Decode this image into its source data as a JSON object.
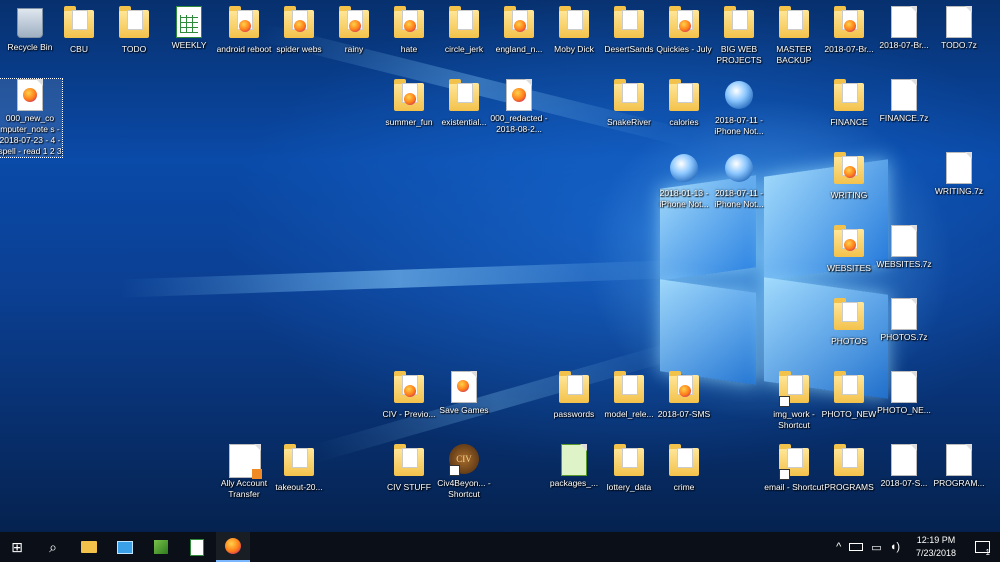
{
  "desktop": {
    "icons": [
      {
        "name": "recycle-bin-icon",
        "type": "bin",
        "label": "Recycle Bin",
        "col": 0,
        "row": 0
      },
      {
        "name": "cbu-folder-icon",
        "type": "folder",
        "label": "CBU",
        "col": 1,
        "row": 0
      },
      {
        "name": "todo-folder-icon",
        "type": "folder",
        "label": "TODO",
        "col": 2,
        "row": 0
      },
      {
        "name": "weekly-spreadsheet-icon",
        "type": "sheet",
        "label": "WEEKLY",
        "col": 3,
        "row": 0
      },
      {
        "name": "android-reboot-folder-icon",
        "type": "folder-ff",
        "label": "android reboot",
        "col": 4,
        "row": 0
      },
      {
        "name": "spider-webs-folder-icon",
        "type": "folder-ff",
        "label": "spider webs",
        "col": 5,
        "row": 0
      },
      {
        "name": "rainy-folder-icon",
        "type": "folder-ff",
        "label": "rainy",
        "col": 6,
        "row": 0
      },
      {
        "name": "hate-folder-icon",
        "type": "folder-ff",
        "label": "hate",
        "col": 7,
        "row": 0
      },
      {
        "name": "circle-jerk-folder-icon",
        "type": "folder",
        "label": "circle_jerk",
        "col": 8,
        "row": 0
      },
      {
        "name": "england-folder-icon",
        "type": "folder-ff",
        "label": "england_n...",
        "col": 9,
        "row": 0
      },
      {
        "name": "moby-dick-folder-icon",
        "type": "folder",
        "label": "Moby Dick",
        "col": 10,
        "row": 0
      },
      {
        "name": "desertsands-folder-icon",
        "type": "folder",
        "label": "DesertSands",
        "col": 11,
        "row": 0
      },
      {
        "name": "quickies-july-folder-icon",
        "type": "folder-ff",
        "label": "Quickies - July",
        "col": 12,
        "row": 0
      },
      {
        "name": "big-web-projects-folder-icon",
        "type": "folder",
        "label": "BIG WEB PROJECTS",
        "col": 13,
        "row": 0
      },
      {
        "name": "master-backup-folder-icon",
        "type": "folder",
        "label": "MASTER BACKUP",
        "col": 14,
        "row": 0
      },
      {
        "name": "br-folder-icon",
        "type": "folder-ff",
        "label": "2018-07-Br...",
        "col": 15,
        "row": 0
      },
      {
        "name": "br-file-icon",
        "type": "file",
        "label": "2018-07-Br...",
        "col": 16,
        "row": 0
      },
      {
        "name": "todo-7z-file-icon",
        "type": "file",
        "label": "TODO.7z",
        "col": 17,
        "row": 0
      },
      {
        "name": "new-computer-notes-firefox-icon",
        "type": "firefox",
        "label": "000_new_co mputer_note s - 2018-07-23 - 4 - spell - read 1 2 3",
        "col": 0,
        "row": 1,
        "selected": true
      },
      {
        "name": "summer-fun-folder-icon",
        "type": "folder-ff",
        "label": "summer_fun",
        "col": 7,
        "row": 1
      },
      {
        "name": "existential-folder-icon",
        "type": "folder",
        "label": "existential...",
        "col": 8,
        "row": 1
      },
      {
        "name": "redacted-firefox-icon",
        "type": "firefox-file",
        "label": "000_redacted - 2018-08-2...",
        "col": 9,
        "row": 1
      },
      {
        "name": "snakeriver-folder-icon",
        "type": "folder",
        "label": "SnakeRiver",
        "col": 11,
        "row": 1
      },
      {
        "name": "calories-folder-icon",
        "type": "folder",
        "label": "calories",
        "col": 12,
        "row": 1
      },
      {
        "name": "iphone-notes-0711-icon",
        "type": "tbird",
        "label": "2018-07-11 - iPhone Not...",
        "col": 13,
        "row": 1
      },
      {
        "name": "finance-folder-icon",
        "type": "folder",
        "label": "FINANCE",
        "col": 15,
        "row": 1
      },
      {
        "name": "finance-7z-file-icon",
        "type": "file",
        "label": "FINANCE.7z",
        "col": 16,
        "row": 1
      },
      {
        "name": "iphone-notes-0113-icon",
        "type": "tbird",
        "label": "2018-01-13 - iPhone Not...",
        "col": 12,
        "row": 2
      },
      {
        "name": "iphone-notes-0711b-icon",
        "type": "tbird",
        "label": "2018-07-11 - iPhone Not...",
        "col": 13,
        "row": 2
      },
      {
        "name": "writing-folder-icon",
        "type": "folder-ff",
        "label": "WRITING",
        "col": 15,
        "row": 2
      },
      {
        "name": "writing-7z-file-icon",
        "type": "file",
        "label": "WRITING.7z",
        "col": 17,
        "row": 2
      },
      {
        "name": "websites-folder-icon",
        "type": "folder-ff",
        "label": "WEBSITES",
        "col": 15,
        "row": 3
      },
      {
        "name": "websites-7z-file-icon",
        "type": "file",
        "label": "WEBSITES.7z",
        "col": 16,
        "row": 3
      },
      {
        "name": "photos-folder-icon",
        "type": "folder",
        "label": "PHOTOS",
        "col": 15,
        "row": 4
      },
      {
        "name": "photos-7z-file-icon",
        "type": "file",
        "label": "PHOTOS.7z",
        "col": 16,
        "row": 4
      },
      {
        "name": "civ-previous-folder-icon",
        "type": "folder-ff",
        "label": "CIV - Previo...",
        "col": 7,
        "row": 5
      },
      {
        "name": "save-games-shortcut-icon",
        "type": "file-ff",
        "label": "Save Games",
        "col": 8,
        "row": 5
      },
      {
        "name": "passwords-folder-icon",
        "type": "folder",
        "label": "passwords",
        "col": 10,
        "row": 5
      },
      {
        "name": "model-release-folder-icon",
        "type": "folder",
        "label": "model_rele...",
        "col": 11,
        "row": 5
      },
      {
        "name": "sms-folder-icon",
        "type": "folder-ff",
        "label": "2018-07-SMS",
        "col": 12,
        "row": 5
      },
      {
        "name": "img-work-shortcut-icon",
        "type": "folder",
        "label": "img_work - Shortcut",
        "col": 14,
        "row": 5,
        "shortcut": true
      },
      {
        "name": "photo-new-folder-icon",
        "type": "folder",
        "label": "PHOTO_NEW",
        "col": 15,
        "row": 5
      },
      {
        "name": "photo-ne-file-icon",
        "type": "file",
        "label": "PHOTO_NE...",
        "col": 16,
        "row": 5
      },
      {
        "name": "ally-account-transfer-icon",
        "type": "doc",
        "label": "Ally Account Transfer",
        "col": 4,
        "row": 6
      },
      {
        "name": "takeout-folder-icon",
        "type": "folder",
        "label": "takeout-20...",
        "col": 5,
        "row": 6
      },
      {
        "name": "civ-stuff-folder-icon",
        "type": "folder",
        "label": "CIV STUFF",
        "col": 7,
        "row": 6
      },
      {
        "name": "civ4-beyond-shortcut-icon",
        "type": "civ",
        "label": "Civ4Beyon... - Shortcut",
        "col": 8,
        "row": 6,
        "shortcut": true
      },
      {
        "name": "packages-icon",
        "type": "packages",
        "label": "packages_...",
        "col": 10,
        "row": 6
      },
      {
        "name": "lottery-data-folder-icon",
        "type": "folder",
        "label": "lottery_data",
        "col": 11,
        "row": 6
      },
      {
        "name": "crime-folder-icon",
        "type": "folder",
        "label": "crime",
        "col": 12,
        "row": 6
      },
      {
        "name": "email-shortcut-icon",
        "type": "folder",
        "label": "email - Shortcut",
        "col": 14,
        "row": 6,
        "shortcut": true
      },
      {
        "name": "programs-folder-icon",
        "type": "folder",
        "label": "PROGRAMS",
        "col": 15,
        "row": 6
      },
      {
        "name": "s-file-icon",
        "type": "file",
        "label": "2018-07-S...",
        "col": 16,
        "row": 6
      },
      {
        "name": "program-file-icon",
        "type": "file",
        "label": "PROGRAM...",
        "col": 17,
        "row": 6
      }
    ]
  },
  "taskbar": {
    "pinned": [
      {
        "name": "start-button",
        "glyph": "⊞"
      },
      {
        "name": "search-button",
        "glyph": "⌕"
      },
      {
        "name": "file-explorer-button",
        "glyph": "folder"
      },
      {
        "name": "network-app-button",
        "glyph": "monitor"
      },
      {
        "name": "green-app-button",
        "glyph": "app"
      },
      {
        "name": "notepad-app-button",
        "glyph": "note"
      },
      {
        "name": "firefox-button",
        "glyph": "firefox",
        "active": true
      }
    ],
    "tray": {
      "chevron": "^",
      "time": "12:19 PM",
      "date": "7/23/2018",
      "notifications": "1"
    }
  }
}
